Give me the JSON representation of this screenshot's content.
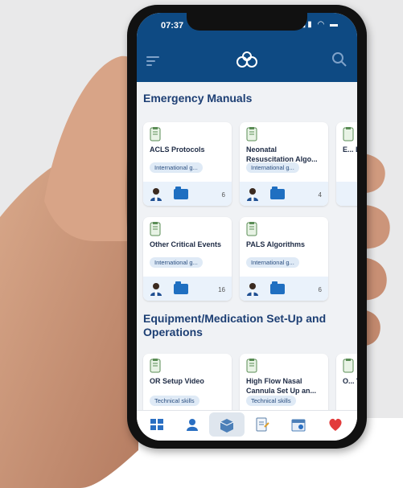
{
  "status": {
    "time": "07:37",
    "icons": "▮▮ ◠ ▬"
  },
  "app": {
    "accent": "#0e4a83",
    "bar_color": "#0e4a83"
  },
  "sections": [
    {
      "title": "Emergency Manuals",
      "cards": [
        {
          "title": "ACLS Protocols",
          "pill": "International g...",
          "count": "6"
        },
        {
          "title": "Neonatal Resuscitation Algo...",
          "pill": "International g...",
          "count": "4"
        },
        {
          "title": "E... L...",
          "pill": "",
          "count": ""
        },
        {
          "title": "Other Critical Events",
          "pill": "International g...",
          "count": "16"
        },
        {
          "title": "PALS Algorithms",
          "pill": "International g...",
          "count": "6"
        }
      ]
    },
    {
      "title": "Equipment/Medication Set-Up and Operations",
      "cards": [
        {
          "title": "OR Setup Video",
          "pill": "Technical skills"
        },
        {
          "title": "High Flow Nasal Cannula Set Up an...",
          "pill": "Technical skills"
        },
        {
          "title": "O... V...",
          "pill": ""
        }
      ]
    }
  ],
  "tabbar": {
    "items": [
      "grid-icon",
      "user-icon",
      "box-icon",
      "notes-icon",
      "calendar-icon",
      "heart-icon"
    ],
    "active": "box-icon"
  }
}
